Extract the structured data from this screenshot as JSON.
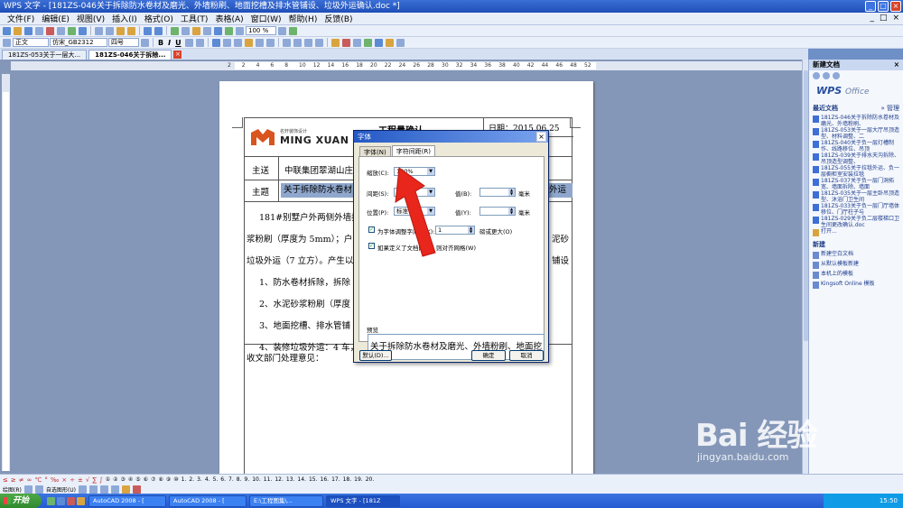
{
  "window": {
    "title": "WPS 文字 - [181ZS-046关于拆除防水卷材及磨光、外墙粉刷、地面挖槽及排水管铺设、垃圾外运确认.doc *]",
    "controls": [
      "_",
      "□",
      "×"
    ]
  },
  "menu": {
    "items": [
      "文件(F)",
      "编辑(E)",
      "视图(V)",
      "插入(I)",
      "格式(O)",
      "工具(T)",
      "表格(A)",
      "窗口(W)",
      "帮助(H)",
      "反馈(B)"
    ]
  },
  "toolbar": {
    "zoom": "100 %",
    "style": "正文",
    "font": "仿宋_GB2312",
    "size": "四号",
    "bold": "B",
    "italic": "I",
    "underline": "U"
  },
  "tabs": [
    {
      "label": "181ZS-053关于一层大..."
    },
    {
      "label": "181ZS-046关于拆除..."
    }
  ],
  "ruler": {
    "marks": [
      "2",
      "2",
      "4",
      "6",
      "8",
      "10",
      "12",
      "14",
      "16",
      "18",
      "20",
      "22",
      "24",
      "26",
      "28",
      "30",
      "32",
      "34",
      "36",
      "38",
      "40",
      "42",
      "44",
      "46",
      "48",
      "52"
    ]
  },
  "document": {
    "logo_small": "名轩装饰设计",
    "logo_large": "MING XUAN",
    "heading_fragment": "工程量确认",
    "date": "日期：2015.06.25",
    "row1_label": "主送",
    "row1_value": "中联集团翠湖山庄",
    "row2_label": "主题",
    "row2_value": "关于拆除防水卷材",
    "row2_tail": "外运",
    "body_lines": [
      "181#别墅户外两侧外墙拆",
      "浆粉刷（厚度为 5mm）；户外",
      "垃圾外运（7 立方）。产生以",
      "1、防水卷材拆除，拆除",
      "2、水泥砂浆粉刷（厚度",
      "3、地面挖槽、排水管铺",
      "4、装修垃圾外运：4 车，"
    ],
    "body_right": [
      "泥砂",
      "铺设"
    ],
    "footer_label": "收文部门处理意见："
  },
  "dialog": {
    "title": "字体",
    "close": "×",
    "tabs": [
      "字体(N)",
      "字符间距(R)"
    ],
    "scale_label": "缩放(C):",
    "scale_value": "100%",
    "spacing_label": "间距(S):",
    "spacing_value": "标准",
    "spacing_value_label": "值(B):",
    "spacing_unit": "毫米",
    "position_label": "位置(P):",
    "position_value": "标准",
    "position_value_label": "值(Y):",
    "position_unit": "毫米",
    "kerning_label": "为字体调整字间距(K):",
    "kerning_value": "1",
    "kerning_suffix": "磅或更大(O)",
    "grid_label": "如果定义了文档网格，则对齐网格(W)",
    "preview_label": "预览",
    "preview_text": "关于拆除防水卷材及磨光、外墙粉刷、地面挖",
    "default_button": "默认(D)...",
    "ok_button": "确定",
    "cancel_button": "取消"
  },
  "taskpane": {
    "title": "新建文档",
    "close": "×",
    "brand": "WPS",
    "brand_suffix": "Office",
    "recent_label": "最近文档",
    "manage": "» 管理",
    "recent_items": [
      "181ZS-046关于拆除防水卷材及磨光、外墙粉刷、",
      "181ZS-053关于一层大厅吊顶造型、材料调整、二",
      "181ZS-040关于负一层灯槽制作、线路移位、吊顶",
      "181ZS-039关于排水天沟拆除、吊顶造型调整、",
      "181ZS-055关于拉毯外运、负一层橱柜室安装拉毯",
      "181ZS-037关于负一层门洞拓宽、墙面拆除、墙面",
      "181ZS-035关于一层主卧吊顶造型、沐浴门卫生间",
      "181ZS-033关于负一层门厅墙体移位、门厅柱子与",
      "181ZS-029关于负二层楼梯口卫生间更改确认.doc"
    ],
    "open_label": "打开...",
    "new_label": "新建",
    "new_items": [
      "新建空白文档",
      "从默认模板新建",
      "本机上的模板",
      "Kingsoft Online 模板"
    ]
  },
  "bottombar": {
    "symbols": [
      "≤",
      "≥",
      "≠",
      "∞",
      "℃",
      "°",
      "‰",
      "×",
      "÷",
      "±",
      "√",
      "∑",
      "∫"
    ],
    "numbers": [
      "①",
      "②",
      "③",
      "④",
      "⑤",
      "⑥",
      "⑦",
      "⑧",
      "⑨",
      "⑩",
      "1.",
      "2.",
      "3.",
      "4.",
      "5.",
      "6.",
      "7.",
      "8.",
      "9.",
      "10.",
      "11.",
      "12.",
      "13.",
      "14.",
      "15.",
      "16.",
      "17.",
      "18.",
      "19.",
      "20."
    ],
    "draw_label": "绘图(R)",
    "autoshape_label": "自选图形(U)"
  },
  "taskbar": {
    "start": "开始",
    "buttons": [
      "AutoCAD 2008 - [",
      "AutoCAD 2008 - [",
      "E:\\工程图集\\...",
      "WPS 文字 - [181Z"
    ],
    "time": "15:50"
  },
  "watermark": {
    "main": "Bai 经验",
    "sub": "jingyan.baidu.com"
  },
  "colors": {
    "accent": "#2459c5",
    "arrow": "#e8261c",
    "logo": "#d9541e"
  }
}
